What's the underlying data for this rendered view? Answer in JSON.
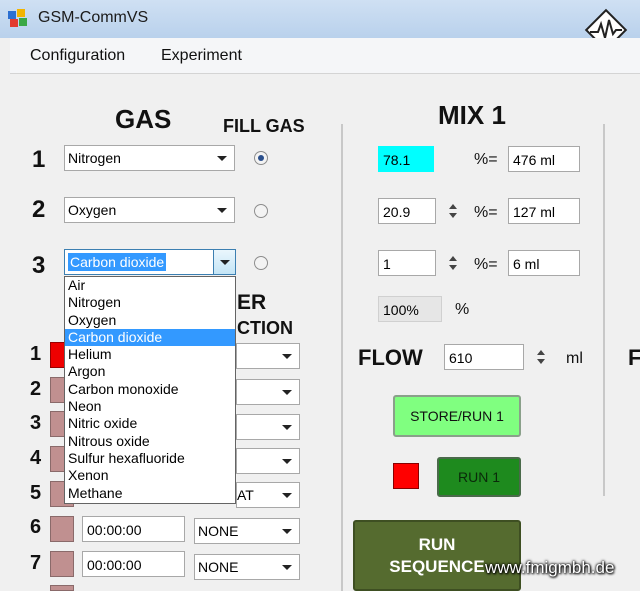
{
  "window": {
    "title": "GSM-CommVS"
  },
  "menu": {
    "configuration": "Configuration",
    "experiment": "Experiment"
  },
  "gas": {
    "heading": "GAS",
    "fill_heading": "FILL GAS",
    "rows": [
      {
        "index": "1",
        "value": "Nitrogen",
        "fill_selected": true
      },
      {
        "index": "2",
        "value": "Oxygen",
        "fill_selected": false
      },
      {
        "index": "3",
        "value": "Carbon dioxide",
        "fill_selected": false
      }
    ],
    "dropdown_options": [
      "Air",
      "Nitrogen",
      "Oxygen",
      "Carbon dioxide",
      "Helium",
      "Argon",
      "Carbon monoxide",
      "Neon",
      "Nitric oxide",
      "Nitrous oxide",
      "Sulfur hexafluoride",
      "Xenon",
      "Methane"
    ],
    "dropdown_selected": "Carbon dioxide"
  },
  "sequence": {
    "heading_line1": "ER",
    "heading_line2": "CTION",
    "rows": [
      {
        "index": "1",
        "action": ""
      },
      {
        "index": "2",
        "action": ""
      },
      {
        "index": "3",
        "action": ""
      },
      {
        "index": "4",
        "action": ""
      },
      {
        "index": "5",
        "action": "AT"
      },
      {
        "index": "6",
        "time": "00:00:00",
        "action": "NONE"
      },
      {
        "index": "7",
        "time": "00:00:00",
        "action": "NONE"
      }
    ]
  },
  "mix": {
    "heading": "MIX 1",
    "rows": [
      {
        "percent": "78.1",
        "equals": "%=",
        "ml": "476 ml"
      },
      {
        "percent": "20.9",
        "equals": "%=",
        "ml": "127 ml"
      },
      {
        "percent": "1",
        "equals": "%=",
        "ml": "6 ml"
      }
    ],
    "total": "100%",
    "total_unit": "%",
    "flow_label": "FLOW",
    "flow_value": "610",
    "flow_unit": "ml",
    "next_flow_label": "F",
    "store_run_button": "STORE/RUN 1",
    "run_button": "RUN 1",
    "run_sequence_line1": "RUN",
    "run_sequence_line2": "SEQUENCE"
  },
  "watermark": "www.fmigmbh.de",
  "colors": {
    "cyan_field": "#00ffff",
    "store_button": "#80ff80",
    "run_button": "#1e8a1e",
    "sequence_button": "#556b2f",
    "status_red": "#ff0000"
  }
}
